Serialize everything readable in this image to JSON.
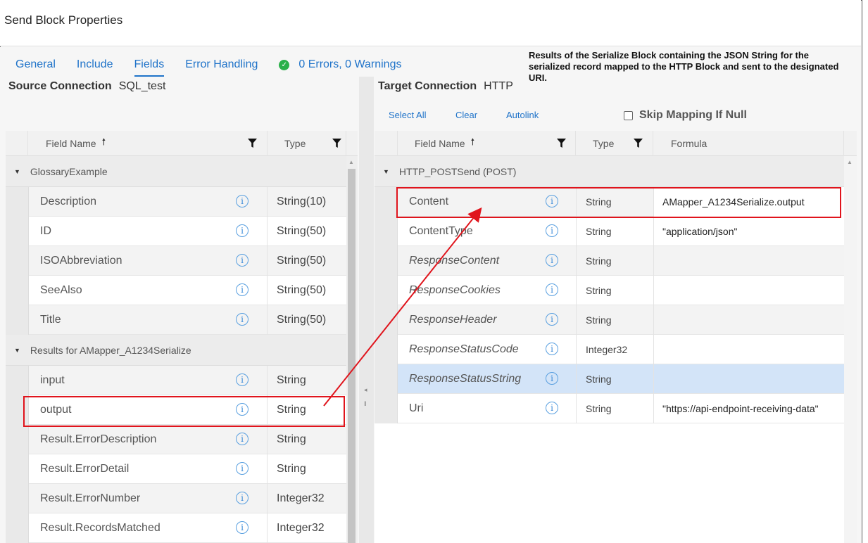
{
  "window": {
    "title": "Send Block Properties"
  },
  "tabs": [
    {
      "label": "General",
      "active": false
    },
    {
      "label": "Include",
      "active": false
    },
    {
      "label": "Fields",
      "active": true
    },
    {
      "label": "Error Handling",
      "active": false
    }
  ],
  "status": {
    "icon": "check-circle-icon",
    "text": "0 Errors, 0 Warnings",
    "color": "#2bb04a"
  },
  "annotation": "Results of the Serialize Block containing the JSON String for the serialized record mapped to the HTTP Block and sent to the designated URI.",
  "source": {
    "label": "Source Connection",
    "value": "SQL_test",
    "headers": {
      "field_name": "Field Name",
      "type": "Type"
    },
    "groups": [
      {
        "name": "GlossaryExample",
        "rows": [
          {
            "name": "Description",
            "type": "String(10)"
          },
          {
            "name": "ID",
            "type": "String(50)"
          },
          {
            "name": "ISOAbbreviation",
            "type": "String(50)"
          },
          {
            "name": "SeeAlso",
            "type": "String(50)"
          },
          {
            "name": "Title",
            "type": "String(50)"
          }
        ]
      },
      {
        "name": "Results for AMapper_A1234Serialize",
        "rows": [
          {
            "name": "input",
            "type": "String"
          },
          {
            "name": "output",
            "type": "String"
          },
          {
            "name": "Result.ErrorDescription",
            "type": "String"
          },
          {
            "name": "Result.ErrorDetail",
            "type": "String"
          },
          {
            "name": "Result.ErrorNumber",
            "type": "Integer32"
          },
          {
            "name": "Result.RecordsMatched",
            "type": "Integer32"
          }
        ]
      }
    ]
  },
  "target": {
    "label": "Target Connection",
    "value": "HTTP",
    "actions": {
      "select_all": "Select All",
      "clear": "Clear",
      "autolink": "Autolink"
    },
    "skip_mapping": {
      "label": "Skip Mapping If Null",
      "checked": false
    },
    "headers": {
      "field_name": "Field Name",
      "type": "Type",
      "formula": "Formula"
    },
    "group": "HTTP_POSTSend (POST)",
    "rows": [
      {
        "name": "Content",
        "type": "String",
        "formula": "AMapper_A1234Serialize.output",
        "italic": false
      },
      {
        "name": "ContentType",
        "type": "String",
        "formula": "\"application/json\"",
        "italic": false
      },
      {
        "name": "ResponseContent",
        "type": "String",
        "formula": "",
        "italic": true
      },
      {
        "name": "ResponseCookies",
        "type": "String",
        "formula": "",
        "italic": true
      },
      {
        "name": "ResponseHeader",
        "type": "String",
        "formula": "",
        "italic": true
      },
      {
        "name": "ResponseStatusCode",
        "type": "Integer32",
        "formula": "",
        "italic": true
      },
      {
        "name": "ResponseStatusString",
        "type": "String",
        "formula": "",
        "italic": true,
        "selected": true
      },
      {
        "name": "Uri",
        "type": "String",
        "formula": "\"https://api-endpoint-receiving-data\"",
        "italic": false
      }
    ]
  },
  "colors": {
    "accent": "#1f73c9",
    "highlight": "#e0141c",
    "selected_row": "#d3e4f8"
  }
}
